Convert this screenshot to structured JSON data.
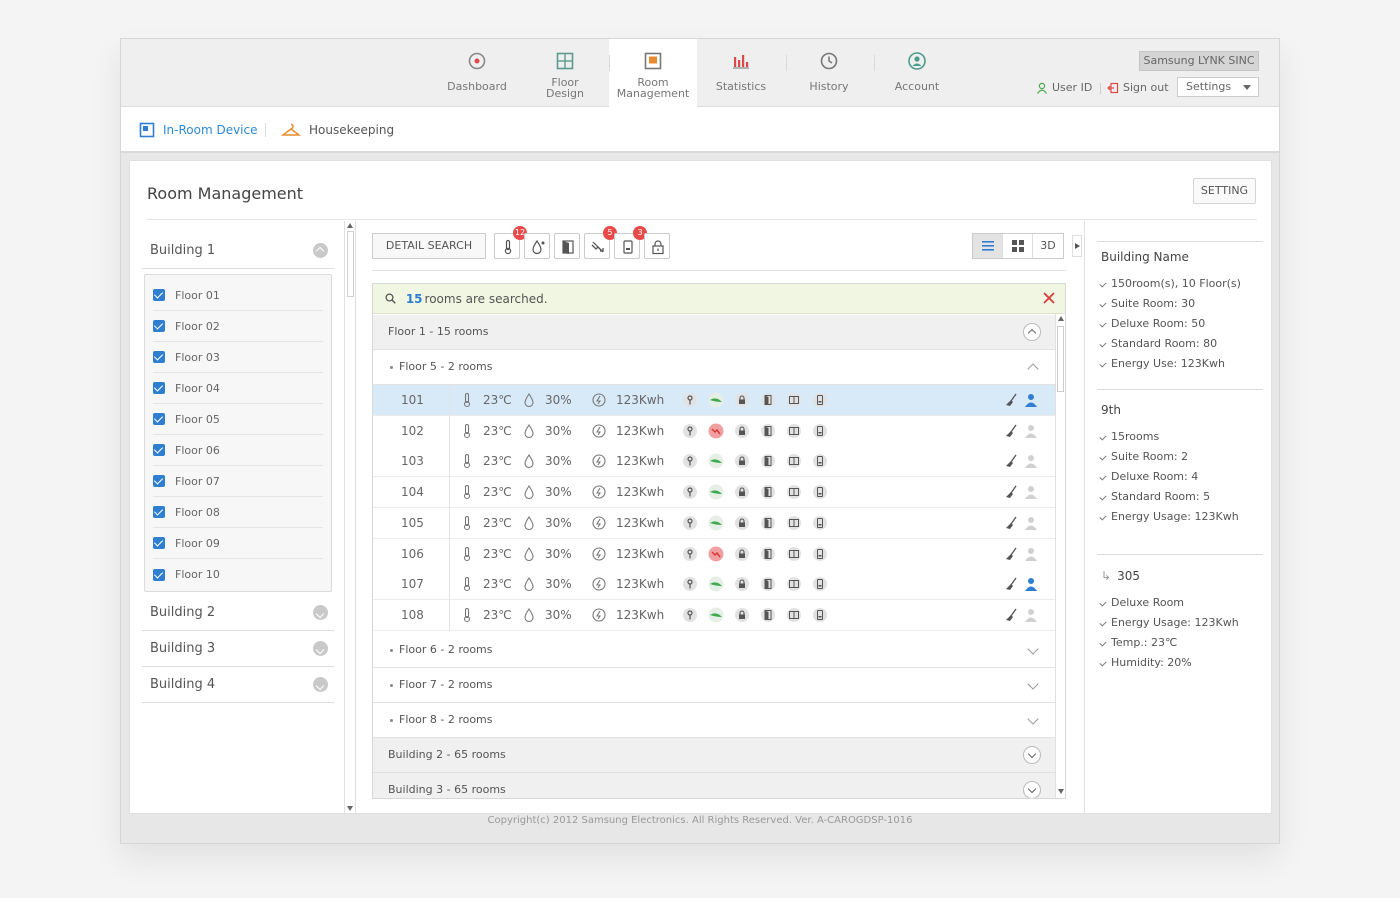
{
  "nav": [
    {
      "label": "Dashboard",
      "icon": "dashboard-icon"
    },
    {
      "label": "Floor Design",
      "l1": "Floor",
      "l2": "Design",
      "icon": "floor-design-icon"
    },
    {
      "label": "Room Management",
      "l1": "Room",
      "l2": "Management",
      "icon": "room-management-icon",
      "active": true
    },
    {
      "label": "Statistics",
      "icon": "statistics-icon"
    },
    {
      "label": "History",
      "icon": "history-icon"
    },
    {
      "label": "Account",
      "icon": "account-icon"
    }
  ],
  "header": {
    "brand": "Samsung LYNK SINC",
    "user_id": "User ID",
    "sign_out": "Sign out",
    "settings": "Settings"
  },
  "subtabs": {
    "in_room": "In-Room Device",
    "housekeeping": "Housekeeping"
  },
  "page": {
    "title": "Room Management",
    "setting_button": "SETTING"
  },
  "buildings": [
    {
      "name": "Building 1",
      "expanded": true
    },
    {
      "name": "Building 2"
    },
    {
      "name": "Building 3"
    },
    {
      "name": "Building 4"
    }
  ],
  "floors": [
    "Floor 01",
    "Floor 02",
    "Floor 03",
    "Floor 04",
    "Floor 05",
    "Floor 06",
    "Floor 07",
    "Floor 08",
    "Floor 09",
    "Floor 10"
  ],
  "toolbar": {
    "detail_search": "DETAIL SEARCH",
    "badges": [
      "12",
      "5",
      "3"
    ],
    "view_3d": "3D"
  },
  "search": {
    "count": "15",
    "text": "rooms are searched."
  },
  "groups": {
    "floor1": "Floor 1  -  15 rooms",
    "floor5": "Floor 5  -  2 rooms",
    "floor6": "Floor 6  -  2 rooms",
    "floor7": "Floor 7  -  2 rooms",
    "floor8": "Floor 8  -  2 rooms",
    "building2": "Building 2  -  65 rooms",
    "building3": "Building 3  -  65 rooms"
  },
  "rooms": [
    {
      "number": "101",
      "temp": "23℃",
      "humidity": "30%",
      "energy": "123Kwh",
      "alert": false,
      "occupied": true,
      "selected": true
    },
    {
      "number": "102",
      "temp": "23℃",
      "humidity": "30%",
      "energy": "123Kwh",
      "alert": true,
      "occupied": false
    },
    {
      "number": "103",
      "temp": "23℃",
      "humidity": "30%",
      "energy": "123Kwh",
      "alert": false,
      "occupied": false
    },
    {
      "number": "104",
      "temp": "23℃",
      "humidity": "30%",
      "energy": "123Kwh",
      "alert": false,
      "occupied": false
    },
    {
      "number": "105",
      "temp": "23℃",
      "humidity": "30%",
      "energy": "123Kwh",
      "alert": false,
      "occupied": false
    },
    {
      "number": "106",
      "temp": "23℃",
      "humidity": "30%",
      "energy": "123Kwh",
      "alert": true,
      "occupied": false
    },
    {
      "number": "107",
      "temp": "23℃",
      "humidity": "30%",
      "energy": "123Kwh",
      "alert": false,
      "occupied": true
    },
    {
      "number": "108",
      "temp": "23℃",
      "humidity": "30%",
      "energy": "123Kwh",
      "alert": false,
      "occupied": false
    }
  ],
  "info": {
    "building": {
      "title": "Building Name",
      "items": [
        "150room(s), 10 Floor(s)",
        "Suite Room: 30",
        "Deluxe Room: 50",
        "Standard Room: 80",
        "Energy Use: 123Kwh"
      ]
    },
    "floor": {
      "title": "9th",
      "items": [
        "15rooms",
        "Suite Room: 2",
        "Deluxe Room: 4",
        "Standard Room: 5",
        "Energy Usage: 123Kwh"
      ]
    },
    "room": {
      "title": "305",
      "items": [
        "Deluxe Room",
        "Energy Usage: 123Kwh",
        "Temp.: 23℃",
        "Humidity: 20%"
      ]
    }
  },
  "footer": "Copyright(c) 2012 Samsung Electronics. All Rights Reserved. Ver. A-CAROGDSP-1016",
  "colors": {
    "accent": "#2e7ed4",
    "alert": "#e84a4a",
    "leaf": "#3daa4e"
  }
}
